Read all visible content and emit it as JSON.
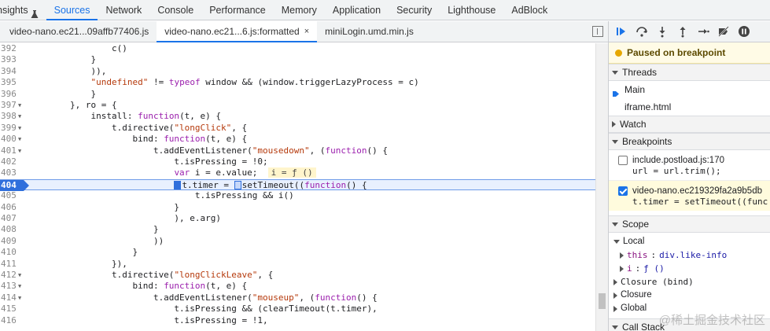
{
  "top_tabs": [
    "nsights",
    "Sources",
    "Network",
    "Console",
    "Performance",
    "Memory",
    "Application",
    "Security",
    "Lighthouse",
    "AdBlock"
  ],
  "active_top_tab": 1,
  "file_tabs": [
    {
      "label": "video-nano.ec21...09affb77406.js",
      "active": false,
      "closable": false
    },
    {
      "label": "video-nano.ec21...6.js:formatted",
      "active": true,
      "closable": true
    },
    {
      "label": "miniLogin.umd.min.js",
      "active": false,
      "closable": false
    }
  ],
  "close_glyph": "×",
  "code_lines": [
    {
      "n": "392",
      "fold": false,
      "segs": [
        {
          "t": "                c()"
        }
      ]
    },
    {
      "n": "393",
      "fold": false,
      "segs": [
        {
          "t": "            }"
        }
      ]
    },
    {
      "n": "394",
      "fold": false,
      "segs": [
        {
          "t": "            )),"
        }
      ]
    },
    {
      "n": "395",
      "fold": false,
      "segs": [
        {
          "t": "            "
        },
        {
          "c": "str",
          "t": "\"undefined\""
        },
        {
          "t": " != "
        },
        {
          "c": "kw",
          "t": "typeof"
        },
        {
          "t": " window && (window.triggerLazyProcess = c)"
        }
      ]
    },
    {
      "n": "396",
      "fold": false,
      "segs": [
        {
          "t": "            }"
        }
      ]
    },
    {
      "n": "397",
      "fold": true,
      "segs": [
        {
          "t": "        }, ro = {"
        }
      ]
    },
    {
      "n": "398",
      "fold": true,
      "segs": [
        {
          "t": "            install: "
        },
        {
          "c": "kw",
          "t": "function"
        },
        {
          "t": "(t, e) {"
        }
      ]
    },
    {
      "n": "399",
      "fold": true,
      "segs": [
        {
          "t": "                t.directive("
        },
        {
          "c": "str",
          "t": "\"longClick\""
        },
        {
          "t": ", {"
        }
      ]
    },
    {
      "n": "400",
      "fold": true,
      "segs": [
        {
          "t": "                    bind: "
        },
        {
          "c": "kw",
          "t": "function"
        },
        {
          "t": "(t, e) {"
        }
      ]
    },
    {
      "n": "401",
      "fold": true,
      "segs": [
        {
          "t": "                        t.addEventListener("
        },
        {
          "c": "str",
          "t": "\"mousedown\""
        },
        {
          "t": ", ("
        },
        {
          "c": "kw",
          "t": "function"
        },
        {
          "t": "() {"
        }
      ]
    },
    {
      "n": "402",
      "fold": false,
      "segs": [
        {
          "t": "                            t.isPressing = !0;"
        }
      ]
    },
    {
      "n": "403",
      "fold": false,
      "segs": [
        {
          "t": "                            "
        },
        {
          "c": "kw",
          "t": "var"
        },
        {
          "t": " i = e.value;  "
        },
        {
          "c": "inl",
          "t": "i = ƒ ()"
        }
      ]
    },
    {
      "n": "404",
      "fold": false,
      "current": true,
      "segs": [
        {
          "t": "                            "
        },
        {
          "c": "marksolid",
          "t": ""
        },
        {
          "t": "t.timer = "
        },
        {
          "c": "mark",
          "t": ""
        },
        {
          "t": "setTimeout(("
        },
        {
          "c": "kw",
          "t": "function"
        },
        {
          "t": "() {"
        }
      ]
    },
    {
      "n": "405",
      "fold": false,
      "segs": [
        {
          "t": "                                t.isPressing && i()"
        }
      ]
    },
    {
      "n": "406",
      "fold": false,
      "segs": [
        {
          "t": "                            }"
        }
      ]
    },
    {
      "n": "407",
      "fold": false,
      "segs": [
        {
          "t": "                            ), e.arg)"
        }
      ]
    },
    {
      "n": "408",
      "fold": false,
      "segs": [
        {
          "t": "                        }"
        }
      ]
    },
    {
      "n": "409",
      "fold": false,
      "segs": [
        {
          "t": "                        ))"
        }
      ]
    },
    {
      "n": "410",
      "fold": false,
      "segs": [
        {
          "t": "                    }"
        }
      ]
    },
    {
      "n": "411",
      "fold": false,
      "segs": [
        {
          "t": "                }),"
        }
      ]
    },
    {
      "n": "412",
      "fold": true,
      "segs": [
        {
          "t": "                t.directive("
        },
        {
          "c": "str",
          "t": "\"longClickLeave\""
        },
        {
          "t": ", {"
        }
      ]
    },
    {
      "n": "413",
      "fold": true,
      "segs": [
        {
          "t": "                    bind: "
        },
        {
          "c": "kw",
          "t": "function"
        },
        {
          "t": "(t, e) {"
        }
      ]
    },
    {
      "n": "414",
      "fold": true,
      "segs": [
        {
          "t": "                        t.addEventListener("
        },
        {
          "c": "str",
          "t": "\"mouseup\""
        },
        {
          "t": ", ("
        },
        {
          "c": "kw",
          "t": "function"
        },
        {
          "t": "() {"
        }
      ]
    },
    {
      "n": "415",
      "fold": false,
      "segs": [
        {
          "t": "                            t.isPressing && (clearTimeout(t.timer),"
        }
      ]
    },
    {
      "n": "416",
      "fold": false,
      "segs": [
        {
          "t": "                            t.isPressing = !1,"
        }
      ]
    }
  ],
  "debugger": {
    "paused": "Paused on breakpoint",
    "threads_title": "Threads",
    "threads": [
      {
        "label": "Main",
        "current": true
      },
      {
        "label": "iframe.html",
        "current": false
      }
    ],
    "watch_title": "Watch",
    "breakpoints_title": "Breakpoints",
    "breakpoints": [
      {
        "file": "include.postload.js:170",
        "code": "url = url.trim();",
        "checked": false,
        "active": false
      },
      {
        "file": "video-nano.ec219329fa2a9b5db",
        "code": "t.timer = setTimeout((func",
        "checked": true,
        "active": true
      }
    ],
    "scope_title": "Scope",
    "local_title": "Local",
    "local_vars": [
      {
        "name": "this",
        "value": "div.like-info"
      },
      {
        "name": "i",
        "value": "ƒ ()"
      }
    ],
    "scope_groups": [
      "Closure (bind)",
      "Closure",
      "Global"
    ],
    "callstack_title": "Call Stack"
  },
  "watermark": "@稀土掘金技术社区",
  "colors": {
    "accent": "#1a73e8",
    "breakpoint": "#2f6fdc",
    "paused_bg": "#fffbe6"
  }
}
